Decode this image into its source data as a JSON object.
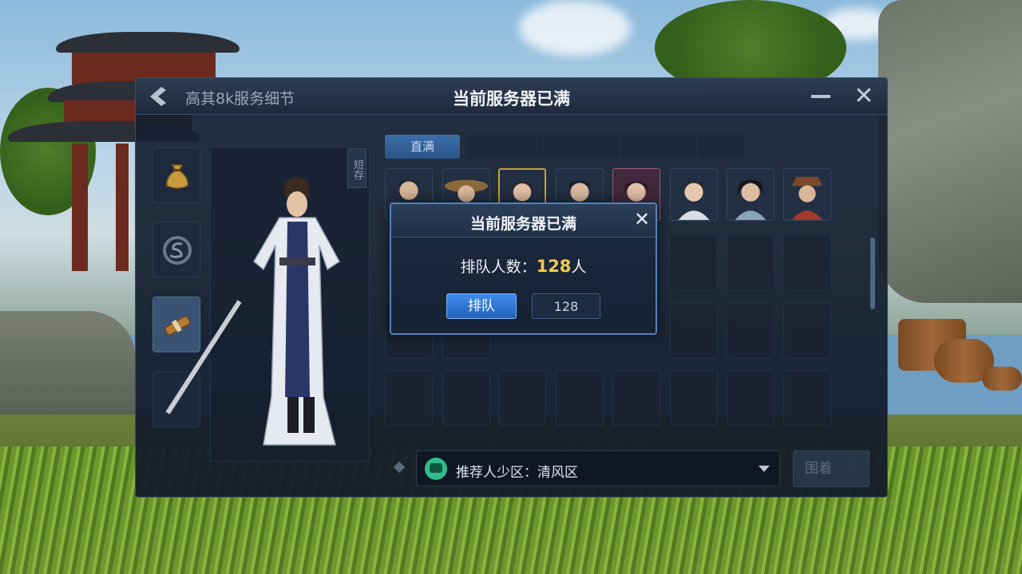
{
  "window": {
    "subtitle": "高其8k服务细节",
    "title": "当前服务器已满",
    "close_glyph": "✕"
  },
  "sidebar": {
    "items": [
      {
        "icon": "money-bag-icon"
      },
      {
        "icon": "silver-coin-icon"
      },
      {
        "icon": "scroll-icon",
        "active": true
      },
      {
        "icon": "empty-slot"
      }
    ]
  },
  "character": {
    "vertical_tag": "短存"
  },
  "tabs": [
    {
      "label": "直满",
      "active": true
    },
    {
      "label": ""
    },
    {
      "label": ""
    },
    {
      "label": ""
    },
    {
      "label": ""
    }
  ],
  "recommend": {
    "text": "推荐人少区：清风区"
  },
  "confirm_label": "围着",
  "modal": {
    "title": "当前服务器已满",
    "close_glyph": "✕",
    "queue_label": "排队人数：",
    "queue_count": "128",
    "queue_unit": "人",
    "queue_button": "排队",
    "queue_input_value": "128"
  },
  "colors": {
    "accent_blue": "#3d8cef",
    "highlight_gold": "#f2c94c",
    "recommend_green": "#2ebd8c"
  }
}
